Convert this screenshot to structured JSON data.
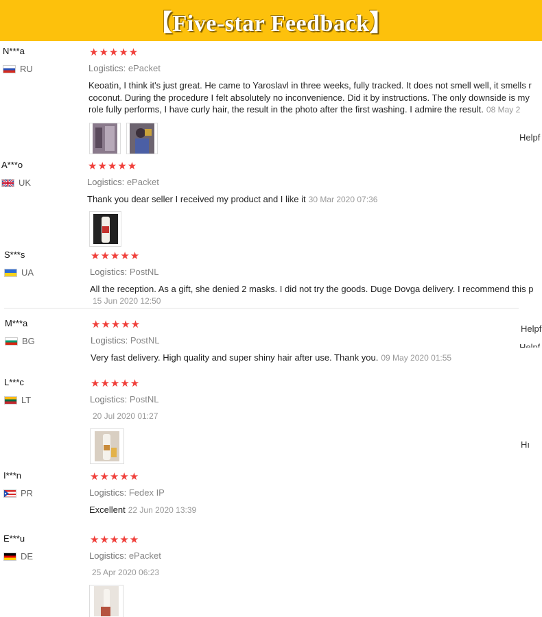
{
  "banner": {
    "title": "【Five-star Feedback】"
  },
  "stars": "★★★★★",
  "logistics_label": "Logistics:",
  "helpful_label": "Helpf",
  "helpful_labels": [
    "Helpf",
    "Helpf",
    "Helpf",
    "Hı"
  ],
  "reviews": [
    {
      "user": "N***a",
      "country": "RU",
      "logistics": "ePacket",
      "text_lines": [
        "Keoatin, I think it's just great. He came to Yaroslavl in three weeks, fully tracked. It does not smell well, it smells r",
        "coconut. During the procedure I felt absolutely no inconvenience. Did it by instructions. The only downside is my",
        "role fully performs, I have curly hair, the result in the photo after the first washing. I admire the result."
      ],
      "date": "08 May 2"
    },
    {
      "user": "A***o",
      "country": "UK",
      "logistics": "ePacket",
      "text": "Thank you dear seller I received my product and I like it",
      "date": "30 Mar 2020 07:36"
    },
    {
      "user": "S***s",
      "country": "UA",
      "logistics": "PostNL",
      "text": "All the reception. As a gift, she denied 2 masks. I did not try the goods. Duge Dovga delivery. I recommend this p",
      "date": "15 Jun 2020 12:50"
    },
    {
      "user": "M***a",
      "country": "BG",
      "logistics": "PostNL",
      "text": "Very fast delivery. High quality and super shiny hair after use. Thank you.",
      "date": "09 May 2020 01:55"
    },
    {
      "user": "L***c",
      "country": "LT",
      "logistics": "PostNL",
      "date": "20 Jul 2020 01:27"
    },
    {
      "user": "I***n",
      "country": "PR",
      "logistics": "Fedex IP",
      "text": "Excellent",
      "date": "22 Jun 2020 13:39"
    },
    {
      "user": "E***u",
      "country": "DE",
      "logistics": "ePacket",
      "date": "25 Apr 2020 06:23"
    }
  ]
}
